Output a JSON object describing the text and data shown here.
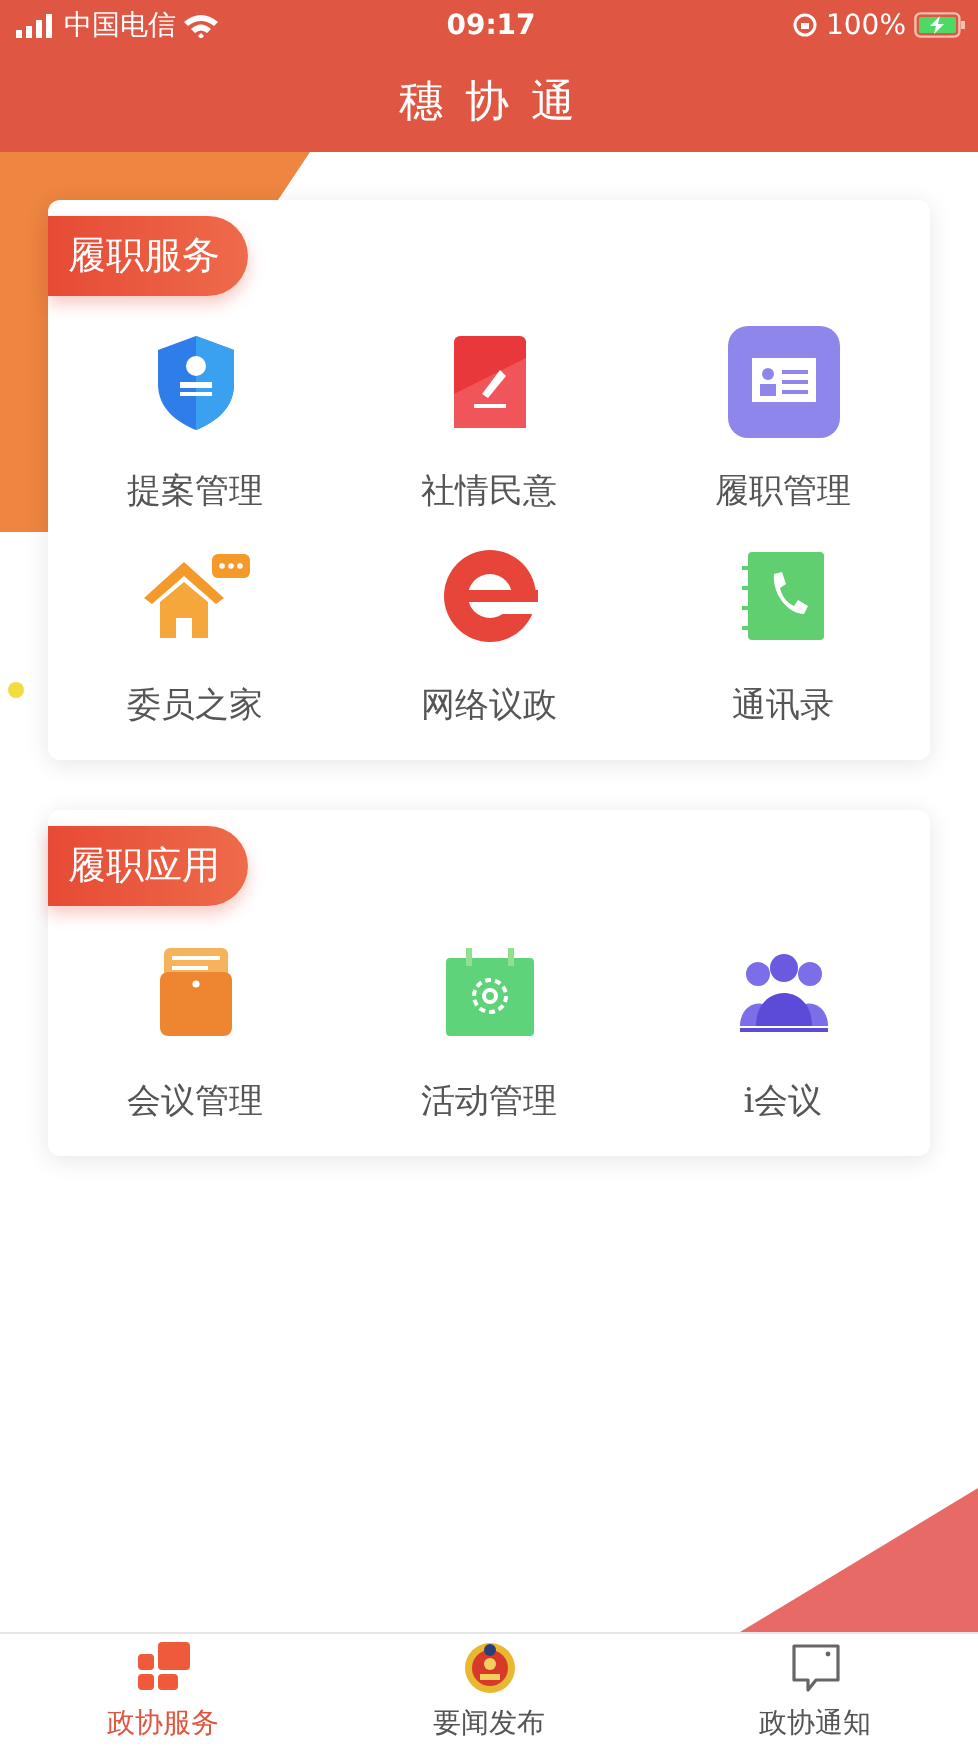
{
  "status_bar": {
    "carrier": "中国电信",
    "time": "09:17",
    "battery": "100%"
  },
  "header": {
    "title": "穗 协 通"
  },
  "sections": [
    {
      "title": "履职服务",
      "items": [
        {
          "label": "提案管理"
        },
        {
          "label": "社情民意"
        },
        {
          "label": "履职管理"
        },
        {
          "label": "委员之家"
        },
        {
          "label": "网络议政"
        },
        {
          "label": "通讯录"
        }
      ]
    },
    {
      "title": "履职应用",
      "items": [
        {
          "label": "会议管理"
        },
        {
          "label": "活动管理"
        },
        {
          "label": "i会议"
        }
      ]
    }
  ],
  "tabs": [
    {
      "label": "政协服务",
      "selected": true
    },
    {
      "label": "要闻发布",
      "selected": false
    },
    {
      "label": "政协通知",
      "selected": false
    }
  ]
}
